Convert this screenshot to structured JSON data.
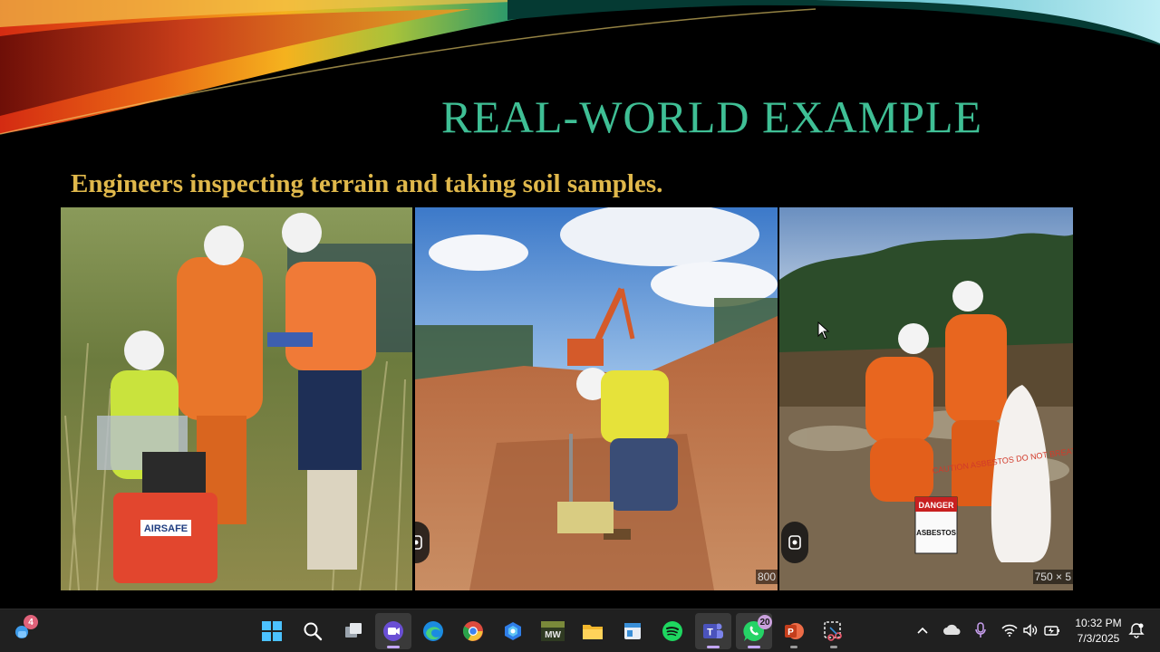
{
  "slide": {
    "title": "REAL-WORLD EXAMPLE",
    "subtitle": "Engineers inspecting terrain and taking soil samples.",
    "title_color": "#3fbf95",
    "subtitle_color": "#e0b84b",
    "photos": [
      {
        "name": "engineers-wetland",
        "case_label": "AIRSAFE"
      },
      {
        "name": "soil-test-trench",
        "size_label": "800"
      },
      {
        "name": "asbestos-sampling",
        "sign_top": "DANGER",
        "sign_bottom": "ASBESTOS",
        "bag_label": "CAUTION ASBESTOS DO NOT BREATHE DUST",
        "size_label": "750 × 5"
      }
    ]
  },
  "taskbar": {
    "widgets_badge": "4",
    "apps": [
      {
        "icon": "windows-start-icon"
      },
      {
        "icon": "search-icon"
      },
      {
        "icon": "task-view-icon"
      },
      {
        "icon": "video-camera-icon"
      },
      {
        "icon": "edge-icon"
      },
      {
        "icon": "chrome-icon"
      },
      {
        "icon": "copilot-icon"
      },
      {
        "icon": "mw-app-icon",
        "label": "MW"
      },
      {
        "icon": "file-explorer-icon"
      },
      {
        "icon": "notepad-icon"
      },
      {
        "icon": "spotify-icon"
      },
      {
        "icon": "teams-icon",
        "label": "T"
      },
      {
        "icon": "whatsapp-icon",
        "badge": "20"
      },
      {
        "icon": "powerpoint-icon",
        "label": "P"
      },
      {
        "icon": "snipping-tool-icon"
      }
    ],
    "clock": {
      "time": "10:32 PM",
      "date": "7/3/2025"
    }
  }
}
